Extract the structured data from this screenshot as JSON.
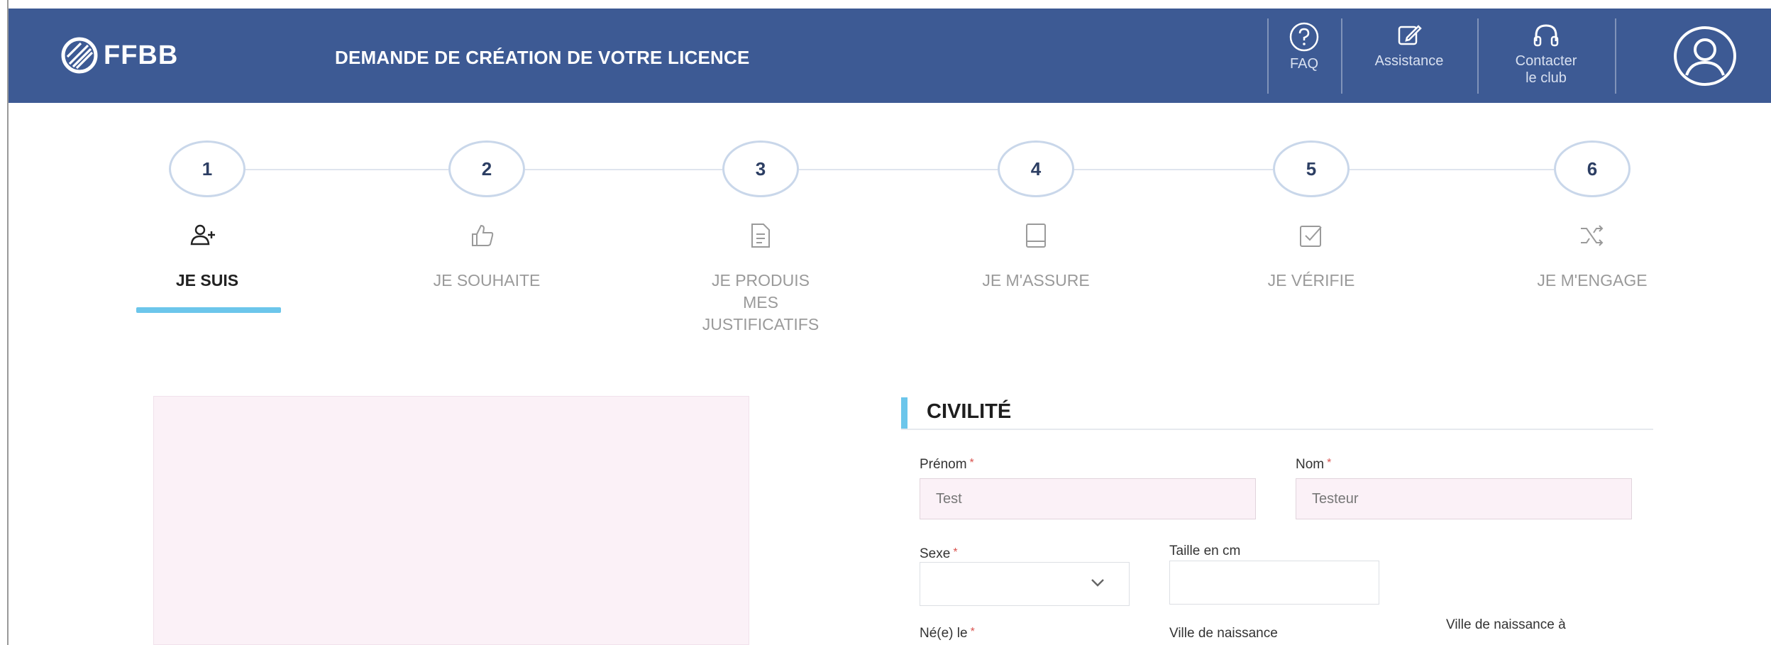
{
  "header": {
    "logo_text": "FFBB",
    "title": "DEMANDE DE CRÉATION DE VOTRE LICENCE",
    "faq_label": "FAQ",
    "assistance_label": "Assistance",
    "contact_line1": "Contacter",
    "contact_line2": "le club",
    "icons": {
      "faq": "question-circle-icon",
      "assistance": "edit-icon",
      "contact": "headset-icon",
      "account": "user-circle-icon"
    },
    "bg_color": "#3d5a94"
  },
  "steps": [
    {
      "number": "1",
      "label": "JE SUIS",
      "icon": "user-plus-icon",
      "active": true
    },
    {
      "number": "2",
      "label": "JE SOUHAITE",
      "icon": "thumbs-up-icon",
      "active": false
    },
    {
      "number": "3",
      "label_line1": "JE PRODUIS",
      "label_line2": "MES",
      "label_line3": "JUSTIFICATIFS",
      "icon": "document-icon",
      "active": false
    },
    {
      "number": "4",
      "label": "JE M'ASSURE",
      "icon": "book-icon",
      "active": false
    },
    {
      "number": "5",
      "label": "JE VÉRIFIE",
      "icon": "check-square-icon",
      "active": false
    },
    {
      "number": "6",
      "label": "JE M'ENGAGE",
      "icon": "shuffle-icon",
      "active": false
    }
  ],
  "accent_color": "#6cc6eb",
  "section": {
    "title": "CIVILITÉ"
  },
  "form": {
    "prenom_label": "Prénom",
    "prenom_value": "Test",
    "nom_label": "Nom",
    "nom_value": "Testeur",
    "sexe_label": "Sexe",
    "sexe_value": "",
    "taille_label": "Taille en cm",
    "taille_value": "",
    "ne_le_label": "Né(e) le",
    "ville_label": "Ville de naissance",
    "ville_etranger_label": "Ville de naissance à",
    "required_mark": "*"
  }
}
